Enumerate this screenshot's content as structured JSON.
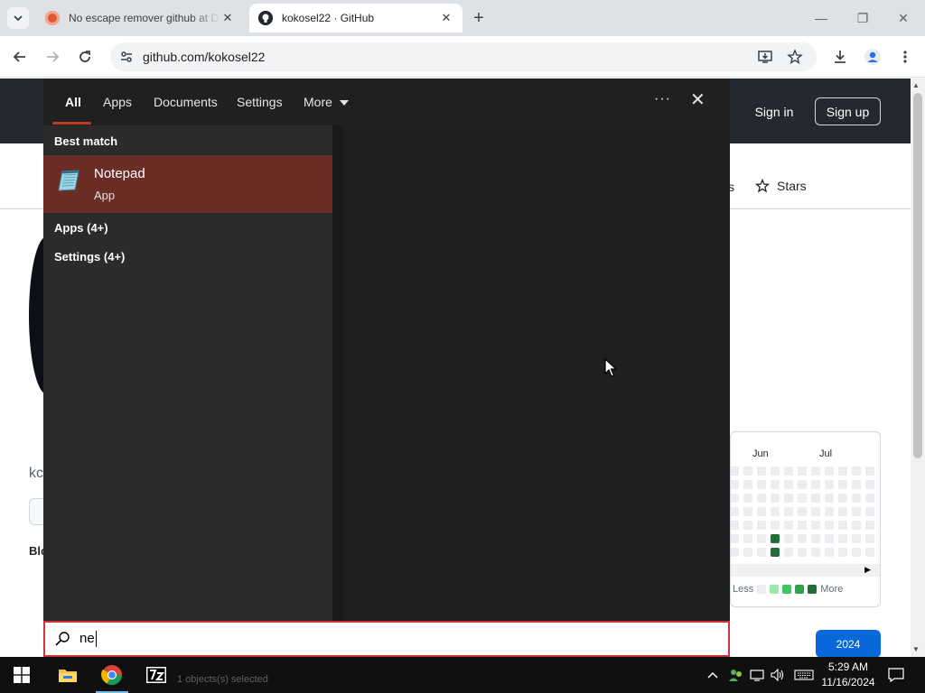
{
  "browser": {
    "tabs": [
      {
        "title": "No escape remover github at D",
        "favicon": "duckduckgo-icon",
        "active": false
      },
      {
        "title": "kokosel22 · GitHub",
        "favicon": "github-icon",
        "active": true
      }
    ],
    "url": "github.com/kokosel22"
  },
  "github": {
    "sign_in": "Sign in",
    "sign_up": "Sign up",
    "stars_label": "Stars",
    "months": [
      "Jun",
      "Jul"
    ],
    "legend_less": "Less",
    "legend_more": "More",
    "year": "2024",
    "fragments": {
      "tab_fragment": "s",
      "name_fragment": "kc",
      "bio_fragment": "Blo"
    }
  },
  "search": {
    "tabs": [
      "All",
      "Apps",
      "Documents",
      "Settings",
      "More"
    ],
    "best_match_label": "Best match",
    "best_match": {
      "name": "Notepad",
      "type": "App"
    },
    "categories": [
      "Apps (4+)",
      "Settings (4+)"
    ],
    "query": "ne",
    "accent_color": "#c0392b"
  },
  "taskbar": {
    "time": "5:29 AM",
    "date": "11/16/2024",
    "background_status": "1 objects(s) selected"
  }
}
